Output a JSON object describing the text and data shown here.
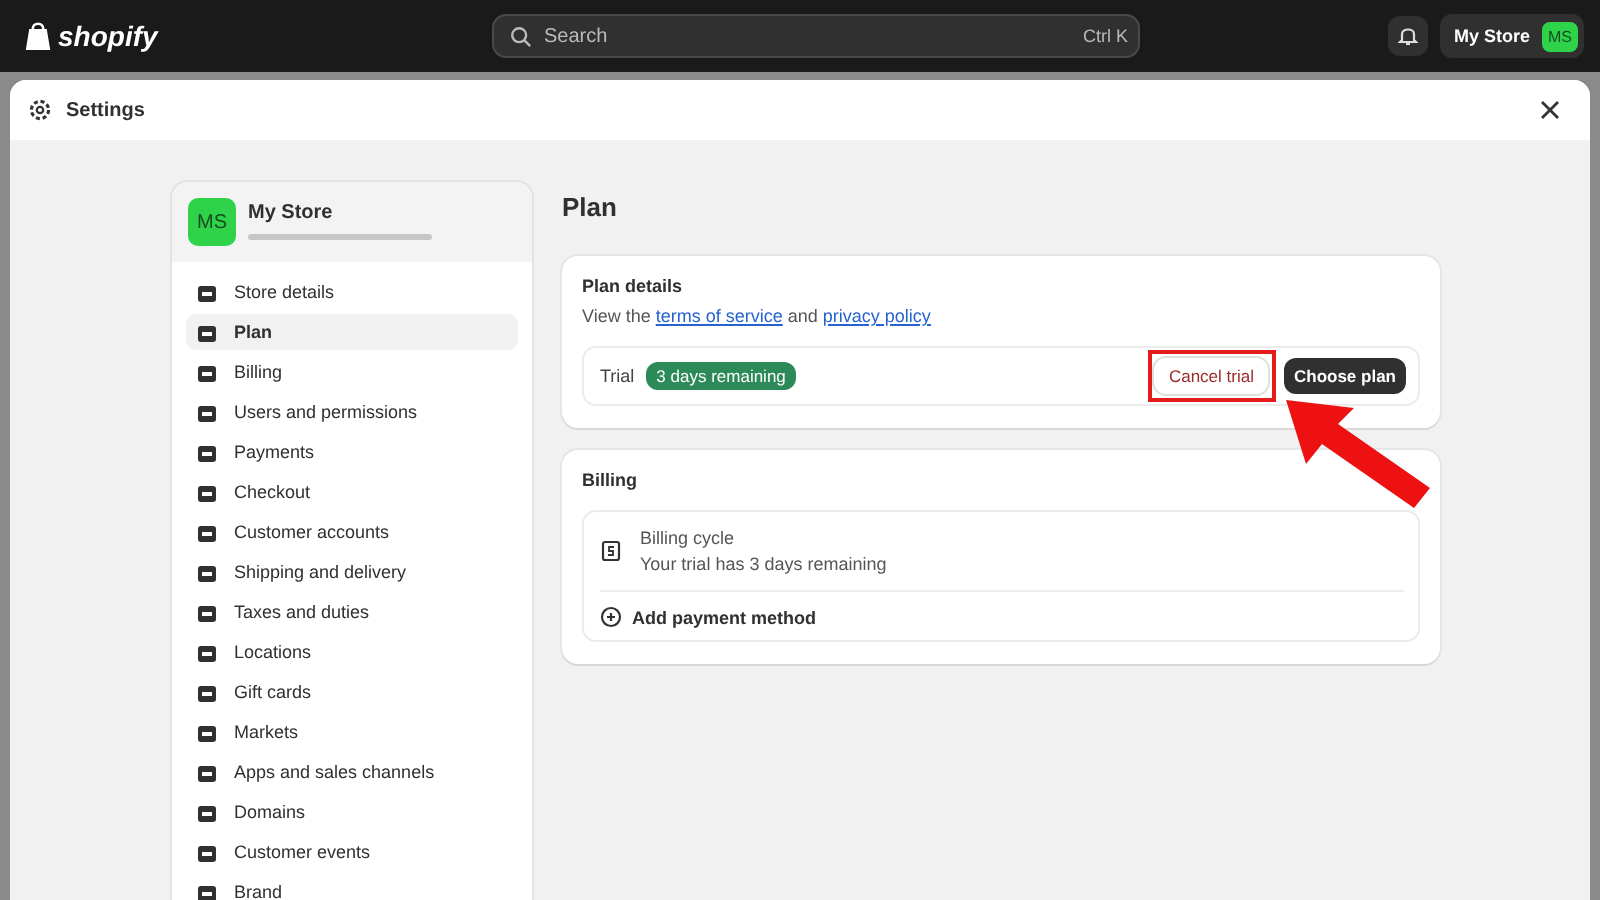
{
  "topbar": {
    "logo": "shopify",
    "search": {
      "placeholder": "Search",
      "shortcut": "Ctrl K"
    },
    "store_button": {
      "label": "My Store",
      "avatar": "MS"
    }
  },
  "modal": {
    "title": "Settings"
  },
  "sidebar": {
    "store": {
      "avatar": "MS",
      "name": "My Store"
    },
    "items": [
      {
        "label": "Store details",
        "selected": false
      },
      {
        "label": "Plan",
        "selected": true
      },
      {
        "label": "Billing",
        "selected": false
      },
      {
        "label": "Users and permissions",
        "selected": false
      },
      {
        "label": "Payments",
        "selected": false
      },
      {
        "label": "Checkout",
        "selected": false
      },
      {
        "label": "Customer accounts",
        "selected": false
      },
      {
        "label": "Shipping and delivery",
        "selected": false
      },
      {
        "label": "Taxes and duties",
        "selected": false
      },
      {
        "label": "Locations",
        "selected": false
      },
      {
        "label": "Gift cards",
        "selected": false
      },
      {
        "label": "Markets",
        "selected": false
      },
      {
        "label": "Apps and sales channels",
        "selected": false
      },
      {
        "label": "Domains",
        "selected": false
      },
      {
        "label": "Customer events",
        "selected": false
      },
      {
        "label": "Brand",
        "selected": false
      }
    ]
  },
  "page_title": "Plan",
  "plan_details": {
    "heading": "Plan details",
    "text_before": "View the",
    "link_1": "terms of service",
    "text_between": "and",
    "link_2": "privacy policy",
    "trial_label": "Trial",
    "trial_badge": "3 days remaining",
    "cancel_button": "Cancel trial",
    "choose_button": "Choose plan"
  },
  "billing": {
    "heading": "Billing",
    "cycle_title": "Billing cycle",
    "cycle_text": "Your trial has 3 days remaining",
    "add_payment": "Add payment method"
  }
}
